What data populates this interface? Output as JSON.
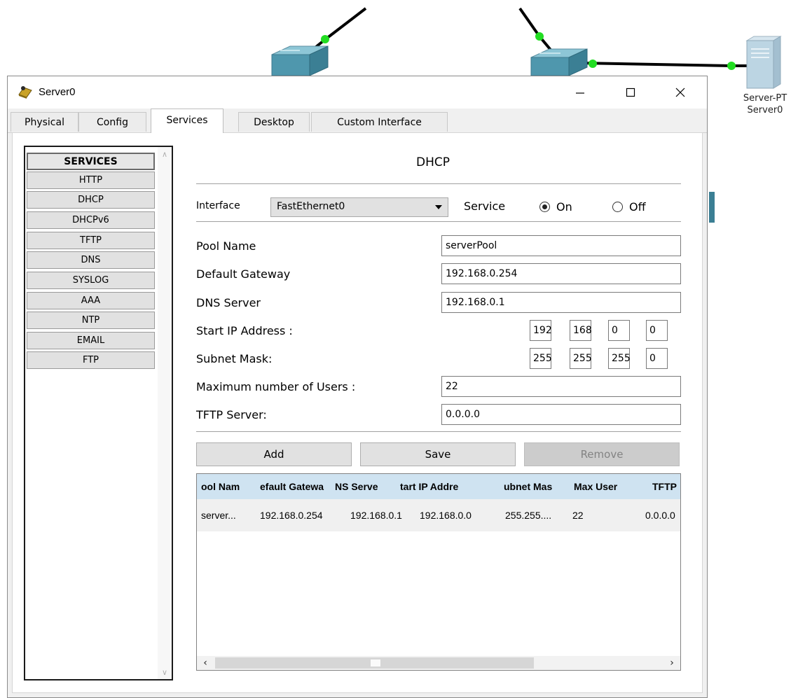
{
  "window": {
    "title": "Server0"
  },
  "background": {
    "server_label_line1": "Server-PT",
    "server_label_line2": "Server0",
    "link_color": "#000000",
    "port_color": "#22dd22"
  },
  "tabs": [
    {
      "label": "Physical"
    },
    {
      "label": "Config"
    },
    {
      "label": "Services",
      "active": true
    },
    {
      "label": "Desktop"
    },
    {
      "label": "Custom Interface"
    }
  ],
  "sidebar": {
    "header": "SERVICES",
    "items": [
      {
        "label": "HTTP"
      },
      {
        "label": "DHCP"
      },
      {
        "label": "DHCPv6"
      },
      {
        "label": "TFTP"
      },
      {
        "label": "DNS"
      },
      {
        "label": "SYSLOG"
      },
      {
        "label": "AAA"
      },
      {
        "label": "NTP"
      },
      {
        "label": "EMAIL"
      },
      {
        "label": "FTP"
      }
    ]
  },
  "dhcp": {
    "title": "DHCP",
    "interface_label": "Interface",
    "interface_value": "FastEthernet0",
    "service_label": "Service",
    "on_label": "On",
    "off_label": "Off",
    "service_state": "On",
    "pool_name_label": "Pool Name",
    "pool_name": "serverPool",
    "default_gateway_label": "Default Gateway",
    "default_gateway": "192.168.0.254",
    "dns_server_label": "DNS Server",
    "dns_server": "192.168.0.1",
    "start_ip_label": "Start IP Address :",
    "start_ip": [
      "192",
      "168",
      "0",
      "0"
    ],
    "subnet_mask_label": "Subnet Mask:",
    "subnet_mask": [
      "255",
      "255",
      "255",
      "0"
    ],
    "max_users_label": "Maximum number of Users :",
    "max_users": "22",
    "tftp_server_label": "TFTP Server:",
    "tftp_server": "0.0.0.0",
    "buttons": {
      "add": "Add",
      "save": "Save",
      "remove": "Remove"
    },
    "table": {
      "columns": [
        "ool Nam",
        "efault Gatewa",
        "NS Serve",
        "tart IP Addre",
        "ubnet Mas",
        "Max User",
        "TFTP"
      ],
      "rows": [
        [
          "server...",
          "192.168.0.254",
          "192.168.0.1",
          "192.168.0.0",
          "255.255....",
          "22",
          "0.0.0.0"
        ]
      ]
    }
  }
}
